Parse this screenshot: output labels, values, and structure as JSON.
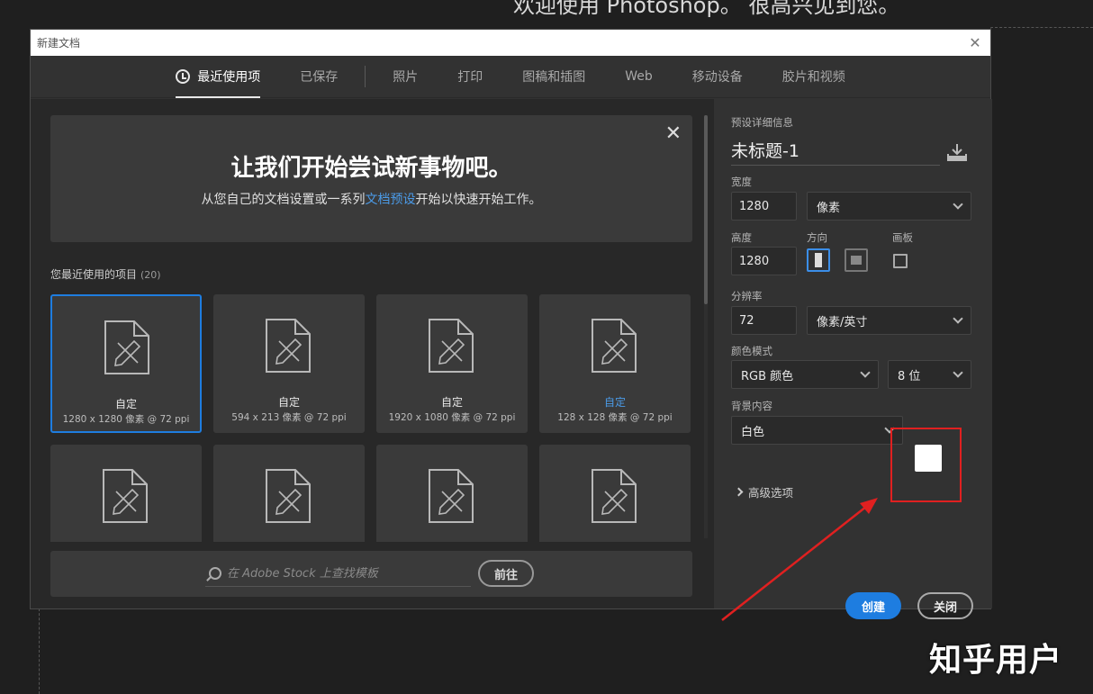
{
  "background": {
    "heading": "欢迎使用 Photoshop。 很高兴见到您。",
    "watermark": "知乎用户"
  },
  "dialog": {
    "title": "新建文档",
    "close_glyph": "✕"
  },
  "tabs": [
    {
      "label": "最近使用项",
      "active": true
    },
    {
      "label": "已保存"
    },
    {
      "label": "照片"
    },
    {
      "label": "打印"
    },
    {
      "label": "图稿和插图"
    },
    {
      "label": "Web"
    },
    {
      "label": "移动设备"
    },
    {
      "label": "胶片和视频"
    }
  ],
  "welcome": {
    "title": "让我们开始尝试新事物吧。",
    "text_before": "从您自己的文档设置或一系列",
    "link": "文档预设",
    "text_after": "开始以快速开始工作。",
    "close_glyph": "✕"
  },
  "recent": {
    "label": "您最近使用的项目",
    "count": "(20)",
    "items": [
      {
        "name": "自定",
        "info": "1280 x 1280 像素 @ 72 ppi",
        "selected": true
      },
      {
        "name": "自定",
        "info": "594 x 213 像素 @ 72 ppi"
      },
      {
        "name": "自定",
        "info": "1920 x 1080 像素 @ 72 ppi"
      },
      {
        "name": "自定",
        "info": "128 x 128 像素 @ 72 ppi",
        "highlight": true
      },
      {
        "name": "",
        "info": ""
      },
      {
        "name": "",
        "info": ""
      },
      {
        "name": "",
        "info": ""
      },
      {
        "name": "",
        "info": ""
      }
    ]
  },
  "stock": {
    "placeholder": "在 Adobe Stock 上查找模板",
    "go_label": "前往"
  },
  "preset": {
    "section_label": "预设详细信息",
    "doc_name": "未标题-1",
    "width_label": "宽度",
    "width_value": "1280",
    "width_unit": "像素",
    "height_label": "高度",
    "height_value": "1280",
    "orientation_label": "方向",
    "artboard_label": "画板",
    "resolution_label": "分辨率",
    "resolution_value": "72",
    "resolution_unit": "像素/英寸",
    "color_mode_label": "颜色模式",
    "color_mode": "RGB 颜色",
    "bit_depth": "8 位",
    "bg_label": "背景内容",
    "bg_value": "白色",
    "bg_swatch_color": "#ffffff",
    "advanced_label": "高级选项",
    "create_label": "创建",
    "close_label": "关闭"
  },
  "colors": {
    "accent": "#1e7de0",
    "highlight_red": "#e02020"
  }
}
